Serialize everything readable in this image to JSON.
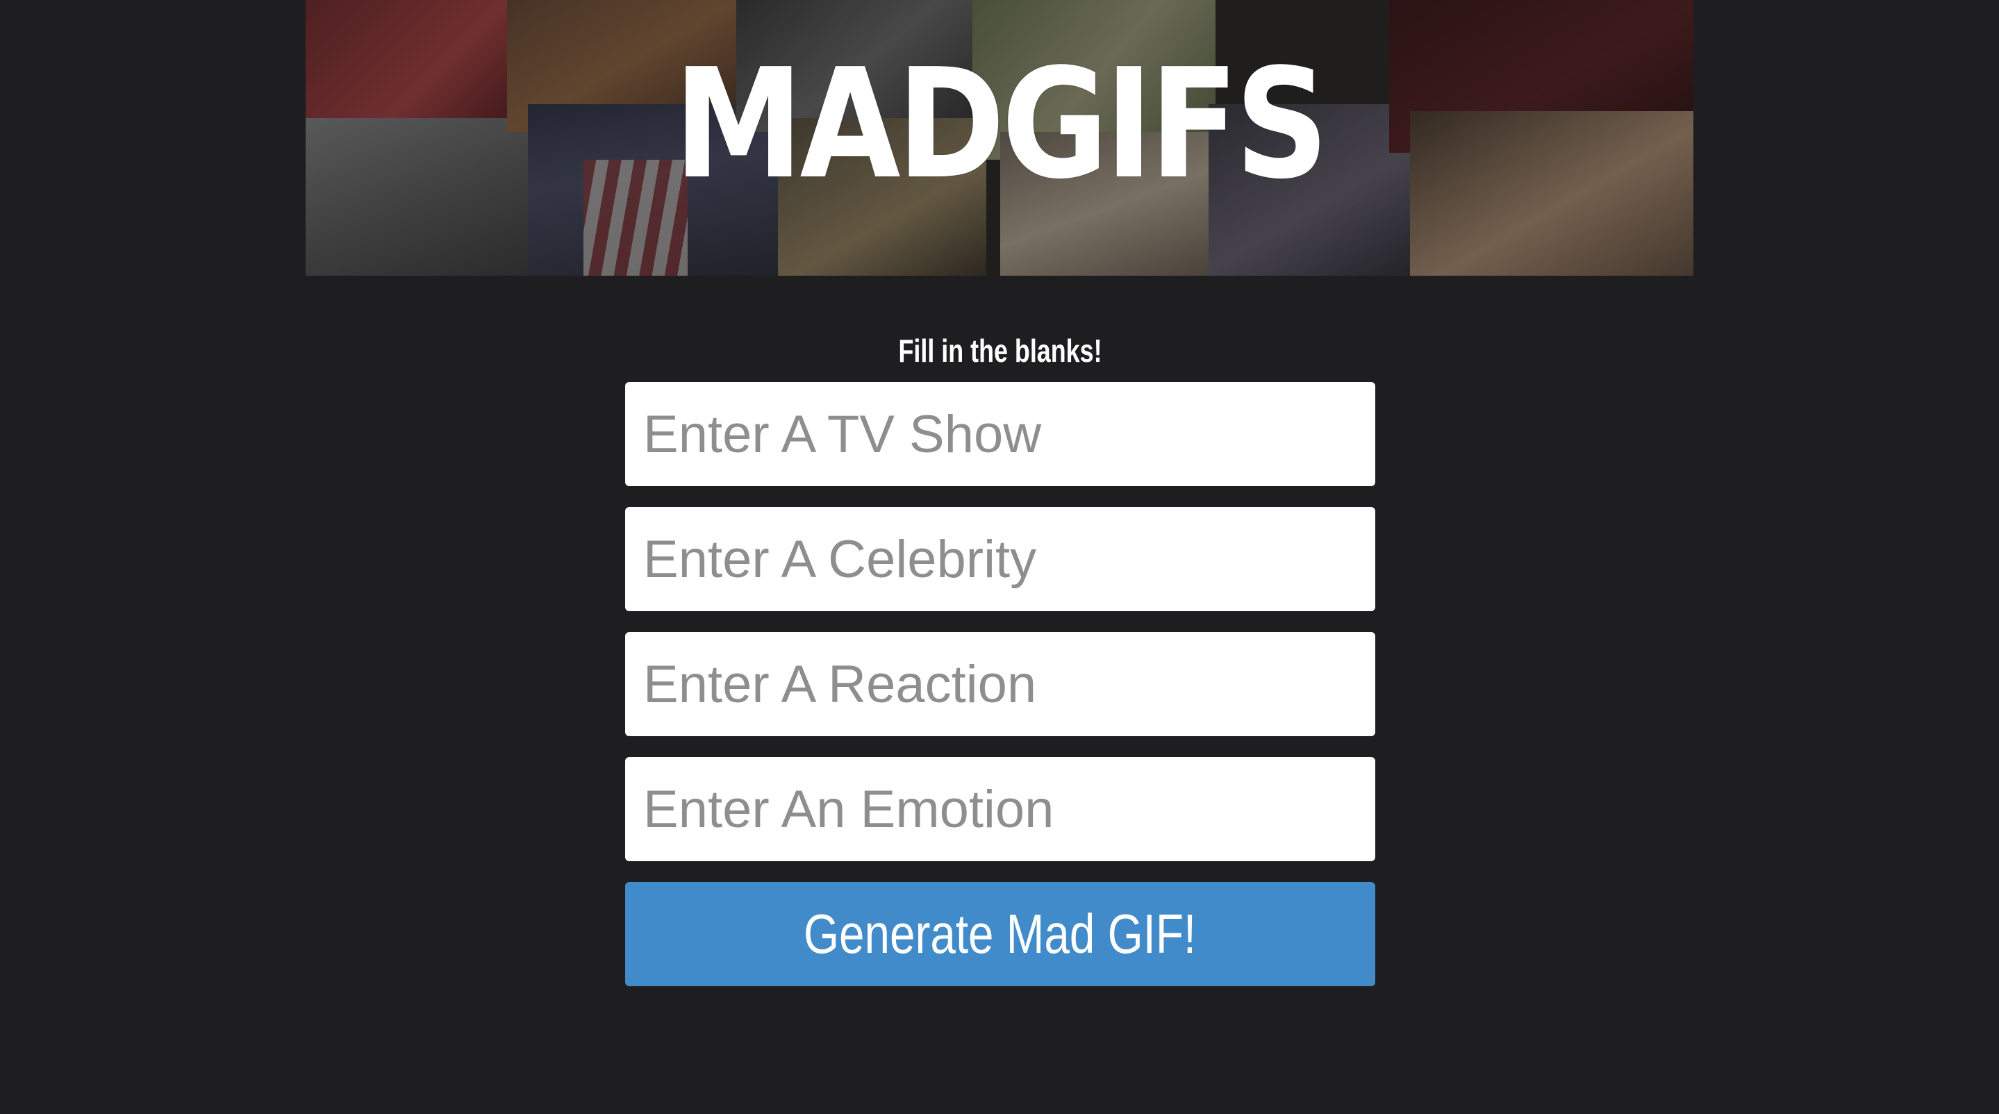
{
  "header": {
    "logo_text": "MADGIFS",
    "background": "photo-collage"
  },
  "form": {
    "prompt": "Fill in the blanks!",
    "fields": [
      {
        "placeholder": "Enter A TV Show",
        "value": ""
      },
      {
        "placeholder": "Enter A Celebrity",
        "value": ""
      },
      {
        "placeholder": "Enter A Reaction",
        "value": ""
      },
      {
        "placeholder": "Enter An Emotion",
        "value": ""
      }
    ],
    "submit_label": "Generate Mad GIF!"
  },
  "colors": {
    "page_background": "#1e1e20",
    "button_accent": "#428bca",
    "field_background": "#ffffff",
    "placeholder_text": "#8e8e8e"
  }
}
